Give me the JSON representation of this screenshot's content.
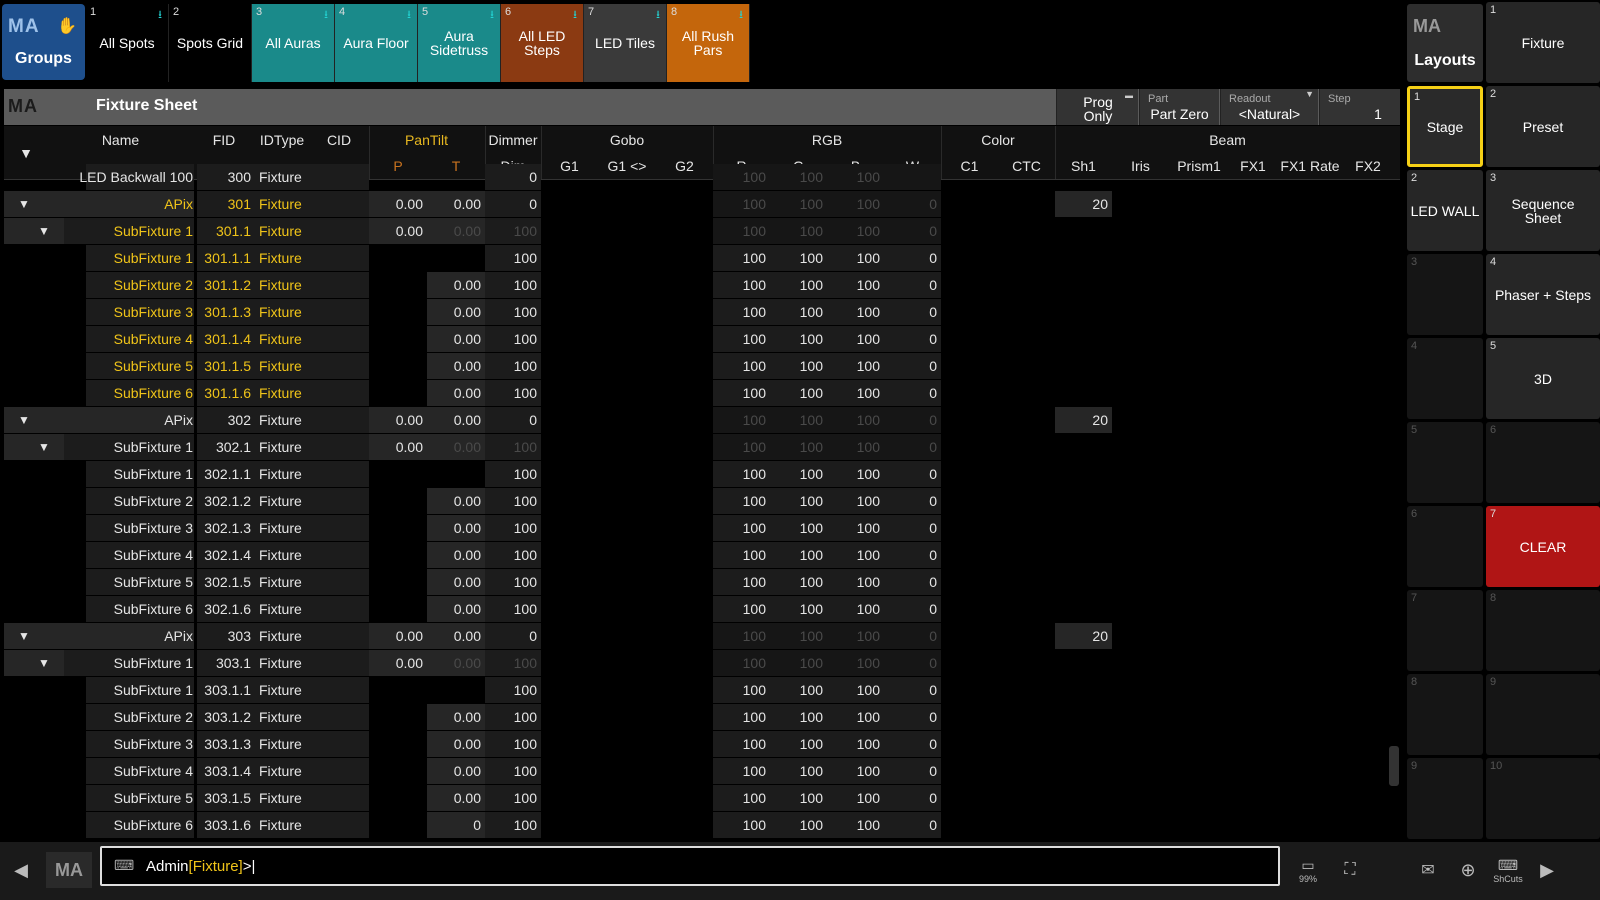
{
  "pool": {
    "title": "Groups",
    "logo": "MA",
    "buttons": [
      {
        "num": "1",
        "label": "All Spots",
        "color": "#000000",
        "arrow": "⭳"
      },
      {
        "num": "2",
        "label": "Spots Grid",
        "color": "#000000",
        "arrow": ""
      },
      {
        "num": "3",
        "label": "All Auras",
        "color": "#1a8a8a",
        "arrow": "⭳"
      },
      {
        "num": "4",
        "label": "Aura Floor",
        "color": "#1a8a8a",
        "arrow": "⭳"
      },
      {
        "num": "5",
        "label": "Aura Sidetruss",
        "color": "#1a8a8a",
        "arrow": "⭳"
      },
      {
        "num": "6",
        "label": "All LED Steps",
        "color": "#8b3a12",
        "arrow": "⭳"
      },
      {
        "num": "7",
        "label": "LED Tiles",
        "color": "#3a3a3a",
        "arrow": "⭳"
      },
      {
        "num": "8",
        "label": "All Rush Pars",
        "color": "#c4660c",
        "arrow": "⭳"
      }
    ]
  },
  "window": {
    "logo": "MA",
    "title": "Fixture Sheet",
    "prog_only": "Prog Only",
    "part_label": "Part",
    "part_value": "Part Zero",
    "readout_label": "Readout",
    "readout_value": "<Natural>",
    "step_label": "Step",
    "step_value": "1"
  },
  "columns": {
    "name": "Name",
    "fid": "FID",
    "idtype": "IDType",
    "cid": "CID",
    "pantilt": "PanTilt",
    "p": "P",
    "t": "T",
    "dimmer": "Dimmer",
    "dim": "Dim",
    "gobo": "Gobo",
    "g1": "G1",
    "g1rot": "G1 <>",
    "g2": "G2",
    "rgb": "RGB",
    "r": "R",
    "g": "G",
    "b": "B",
    "w": "W",
    "color": "Color",
    "c1": "C1",
    "ctc": "CTC",
    "beam": "Beam",
    "sh1": "Sh1",
    "iris": "Iris",
    "prism1": "Prism1",
    "fx1": "FX1",
    "fx1rate": "FX1 Rate",
    "fx2": "FX2"
  },
  "rows": [
    {
      "name": "LED Backwall 100",
      "fid": "300",
      "idtype": "Fixture",
      "p": "",
      "t": "",
      "dim": "0",
      "r": "100",
      "g": "100",
      "b": "100",
      "w": "",
      "sh1": "",
      "level": "partial"
    },
    {
      "name": "APix",
      "fid": "301",
      "idtype": "Fixture",
      "p": "0.00",
      "t": "0.00",
      "dim": "0",
      "r": "100",
      "g": "100",
      "b": "100",
      "w": "0",
      "sh1": "20",
      "level": 0,
      "selected": true
    },
    {
      "name": "SubFixture 1",
      "fid": "301.1",
      "idtype": "Fixture",
      "p": "0.00",
      "t": "0.00",
      "dim": "100",
      "r": "100",
      "g": "100",
      "b": "100",
      "w": "0",
      "sh1": "",
      "level": 1,
      "selected": true
    },
    {
      "name": "SubFixture 1",
      "fid": "301.1.1",
      "idtype": "Fixture",
      "p": "",
      "t": "",
      "dim": "100",
      "r": "100",
      "g": "100",
      "b": "100",
      "w": "0",
      "sh1": "",
      "level": 2,
      "selected": true
    },
    {
      "name": "SubFixture 2",
      "fid": "301.1.2",
      "idtype": "Fixture",
      "p": "",
      "t": "0.00",
      "dim": "100",
      "r": "100",
      "g": "100",
      "b": "100",
      "w": "0",
      "sh1": "",
      "level": 2,
      "selected": true
    },
    {
      "name": "SubFixture 3",
      "fid": "301.1.3",
      "idtype": "Fixture",
      "p": "",
      "t": "0.00",
      "dim": "100",
      "r": "100",
      "g": "100",
      "b": "100",
      "w": "0",
      "sh1": "",
      "level": 2,
      "selected": true
    },
    {
      "name": "SubFixture 4",
      "fid": "301.1.4",
      "idtype": "Fixture",
      "p": "",
      "t": "0.00",
      "dim": "100",
      "r": "100",
      "g": "100",
      "b": "100",
      "w": "0",
      "sh1": "",
      "level": 2,
      "selected": true
    },
    {
      "name": "SubFixture 5",
      "fid": "301.1.5",
      "idtype": "Fixture",
      "p": "",
      "t": "0.00",
      "dim": "100",
      "r": "100",
      "g": "100",
      "b": "100",
      "w": "0",
      "sh1": "",
      "level": 2,
      "selected": true
    },
    {
      "name": "SubFixture 6",
      "fid": "301.1.6",
      "idtype": "Fixture",
      "p": "",
      "t": "0.00",
      "dim": "100",
      "r": "100",
      "g": "100",
      "b": "100",
      "w": "0",
      "sh1": "",
      "level": 2,
      "selected": true
    },
    {
      "name": "APix",
      "fid": "302",
      "idtype": "Fixture",
      "p": "0.00",
      "t": "0.00",
      "dim": "0",
      "r": "100",
      "g": "100",
      "b": "100",
      "w": "0",
      "sh1": "20",
      "level": 0
    },
    {
      "name": "SubFixture 1",
      "fid": "302.1",
      "idtype": "Fixture",
      "p": "0.00",
      "t": "0.00",
      "dim": "100",
      "r": "100",
      "g": "100",
      "b": "100",
      "w": "0",
      "sh1": "",
      "level": 1
    },
    {
      "name": "SubFixture 1",
      "fid": "302.1.1",
      "idtype": "Fixture",
      "p": "",
      "t": "",
      "dim": "100",
      "r": "100",
      "g": "100",
      "b": "100",
      "w": "0",
      "sh1": "",
      "level": 2
    },
    {
      "name": "SubFixture 2",
      "fid": "302.1.2",
      "idtype": "Fixture",
      "p": "",
      "t": "0.00",
      "dim": "100",
      "r": "100",
      "g": "100",
      "b": "100",
      "w": "0",
      "sh1": "",
      "level": 2
    },
    {
      "name": "SubFixture 3",
      "fid": "302.1.3",
      "idtype": "Fixture",
      "p": "",
      "t": "0.00",
      "dim": "100",
      "r": "100",
      "g": "100",
      "b": "100",
      "w": "0",
      "sh1": "",
      "level": 2
    },
    {
      "name": "SubFixture 4",
      "fid": "302.1.4",
      "idtype": "Fixture",
      "p": "",
      "t": "0.00",
      "dim": "100",
      "r": "100",
      "g": "100",
      "b": "100",
      "w": "0",
      "sh1": "",
      "level": 2
    },
    {
      "name": "SubFixture 5",
      "fid": "302.1.5",
      "idtype": "Fixture",
      "p": "",
      "t": "0.00",
      "dim": "100",
      "r": "100",
      "g": "100",
      "b": "100",
      "w": "0",
      "sh1": "",
      "level": 2
    },
    {
      "name": "SubFixture 6",
      "fid": "302.1.6",
      "idtype": "Fixture",
      "p": "",
      "t": "0.00",
      "dim": "100",
      "r": "100",
      "g": "100",
      "b": "100",
      "w": "0",
      "sh1": "",
      "level": 2
    },
    {
      "name": "APix",
      "fid": "303",
      "idtype": "Fixture",
      "p": "0.00",
      "t": "0.00",
      "dim": "0",
      "r": "100",
      "g": "100",
      "b": "100",
      "w": "0",
      "sh1": "20",
      "level": 0
    },
    {
      "name": "SubFixture 1",
      "fid": "303.1",
      "idtype": "Fixture",
      "p": "0.00",
      "t": "0.00",
      "dim": "100",
      "r": "100",
      "g": "100",
      "b": "100",
      "w": "0",
      "sh1": "",
      "level": 1
    },
    {
      "name": "SubFixture 1",
      "fid": "303.1.1",
      "idtype": "Fixture",
      "p": "",
      "t": "",
      "dim": "100",
      "r": "100",
      "g": "100",
      "b": "100",
      "w": "0",
      "sh1": "",
      "level": 2
    },
    {
      "name": "SubFixture 2",
      "fid": "303.1.2",
      "idtype": "Fixture",
      "p": "",
      "t": "0.00",
      "dim": "100",
      "r": "100",
      "g": "100",
      "b": "100",
      "w": "0",
      "sh1": "",
      "level": 2
    },
    {
      "name": "SubFixture 3",
      "fid": "303.1.3",
      "idtype": "Fixture",
      "p": "",
      "t": "0.00",
      "dim": "100",
      "r": "100",
      "g": "100",
      "b": "100",
      "w": "0",
      "sh1": "",
      "level": 2
    },
    {
      "name": "SubFixture 4",
      "fid": "303.1.4",
      "idtype": "Fixture",
      "p": "",
      "t": "0.00",
      "dim": "100",
      "r": "100",
      "g": "100",
      "b": "100",
      "w": "0",
      "sh1": "",
      "level": 2
    },
    {
      "name": "SubFixture 5",
      "fid": "303.1.5",
      "idtype": "Fixture",
      "p": "",
      "t": "0.00",
      "dim": "100",
      "r": "100",
      "g": "100",
      "b": "100",
      "w": "0",
      "sh1": "",
      "level": 2
    },
    {
      "name": "SubFixture 6",
      "fid": "303.1.6",
      "idtype": "Fixture",
      "p": "",
      "t": "0",
      "dim": "100",
      "r": "100",
      "g": "100",
      "b": "100",
      "w": "0",
      "sh1": "",
      "level": 2
    }
  ],
  "layouts": {
    "logo": "MA",
    "title": "Layouts",
    "left_col": [
      {
        "num": "1",
        "label": "Stage",
        "active": true
      },
      {
        "num": "2",
        "label": "LED WALL"
      },
      {
        "num": "3",
        "label": ""
      },
      {
        "num": "4",
        "label": ""
      },
      {
        "num": "5",
        "label": ""
      },
      {
        "num": "6",
        "label": ""
      },
      {
        "num": "7",
        "label": ""
      },
      {
        "num": "8",
        "label": ""
      },
      {
        "num": "9",
        "label": ""
      }
    ],
    "right_col": [
      {
        "num": "1",
        "label": "Fixture"
      },
      {
        "num": "2",
        "label": "Preset"
      },
      {
        "num": "3",
        "label": "Sequence Sheet"
      },
      {
        "num": "4",
        "label": "Phaser + Steps"
      },
      {
        "num": "5",
        "label": "3D"
      },
      {
        "num": "6",
        "label": ""
      },
      {
        "num": "7",
        "label": "CLEAR",
        "red": true
      },
      {
        "num": "8",
        "label": ""
      },
      {
        "num": "9",
        "label": ""
      },
      {
        "num": "10",
        "label": ""
      }
    ]
  },
  "commandline": {
    "user": "Admin",
    "object": "[Fixture]",
    "prompt": ">",
    "logo": "MA",
    "zoom": "99%",
    "shortcuts": "ShCuts"
  },
  "colors": {
    "selected_text": "#f0c419",
    "clear_red": "#b01515",
    "active_border": "#f5d016",
    "groups_blue": "#1e4f8c"
  }
}
